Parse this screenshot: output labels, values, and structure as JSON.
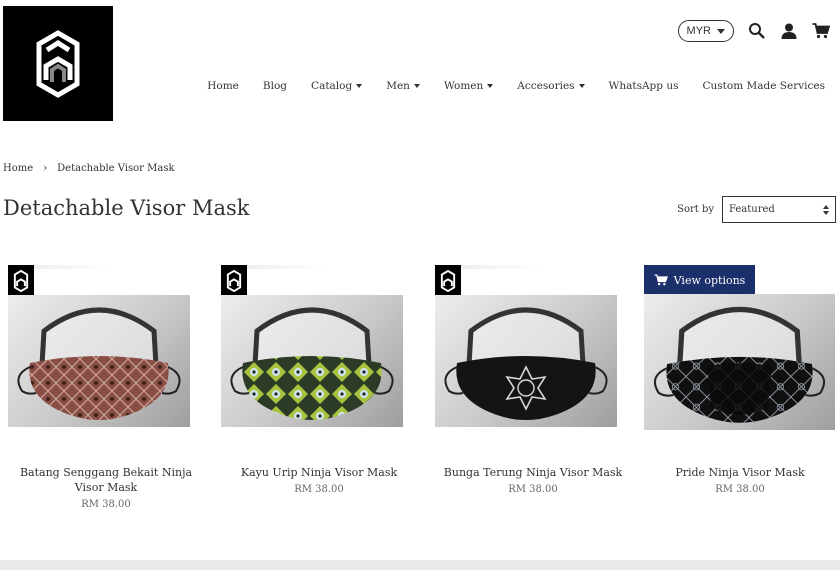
{
  "header": {
    "currency": "MYR",
    "icons": [
      "search-icon",
      "account-icon",
      "cart-icon"
    ]
  },
  "nav": {
    "items": [
      {
        "label": "Home",
        "dropdown": false
      },
      {
        "label": "Blog",
        "dropdown": false
      },
      {
        "label": "Catalog",
        "dropdown": true
      },
      {
        "label": "Men",
        "dropdown": true
      },
      {
        "label": "Women",
        "dropdown": true
      },
      {
        "label": "Accesories",
        "dropdown": true
      },
      {
        "label": "WhatsApp us",
        "dropdown": false
      },
      {
        "label": "Custom Made Services",
        "dropdown": false
      }
    ]
  },
  "breadcrumb": {
    "home": "Home",
    "separator": "›",
    "current": "Detachable Visor Mask"
  },
  "page": {
    "title": "Detachable Visor Mask",
    "sort_label": "Sort by",
    "sort_value": "Featured"
  },
  "products": [
    {
      "title": "Batang Senggang Bekait Ninja Visor Mask",
      "price": "RM 38.00",
      "pattern": "red-geometric"
    },
    {
      "title": "Kayu Urip Ninja Visor Mask",
      "price": "RM 38.00",
      "pattern": "yellow-motif"
    },
    {
      "title": "Bunga Terung Ninja Visor Mask",
      "price": "RM 38.00",
      "pattern": "black-flower"
    },
    {
      "title": "Pride Ninja Visor Mask",
      "price": "RM 38.00",
      "pattern": "black-lines"
    }
  ],
  "view_options_label": "View options",
  "colors": {
    "accent": "#1b2f6b",
    "logo_bg": "#000000",
    "text": "#333333"
  }
}
